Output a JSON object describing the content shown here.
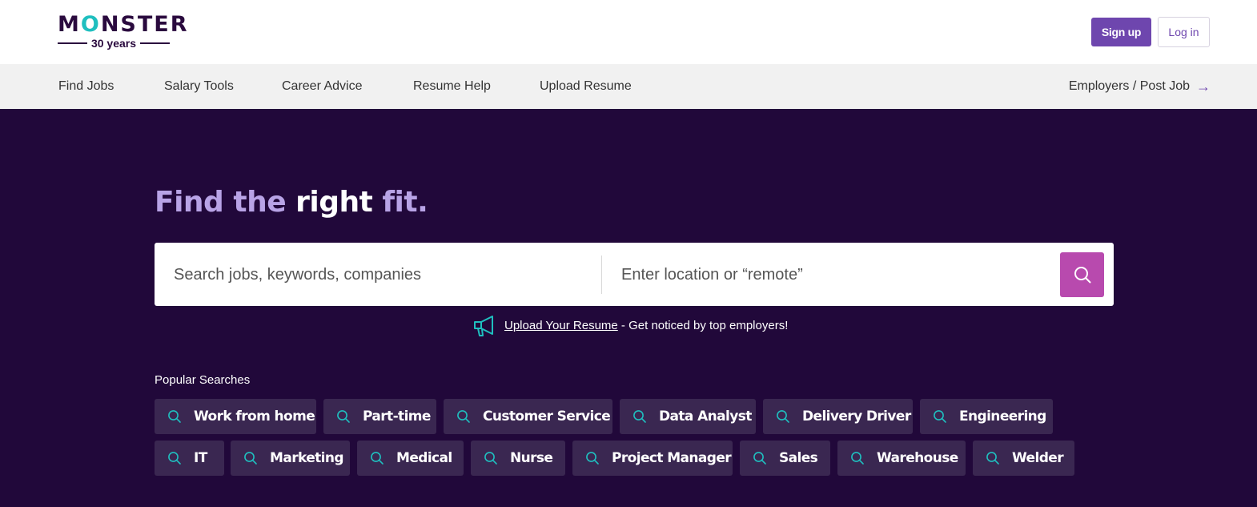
{
  "brand": {
    "name": "MONSTER",
    "tagline": "30 years",
    "colors": {
      "accent": "#6e46ae",
      "hero_bg": "#21083a",
      "teal": "#1fbfbf",
      "search_button": "#b84aae"
    }
  },
  "header": {
    "signup_label": "Sign up",
    "login_label": "Log in"
  },
  "nav": {
    "items": [
      {
        "label": "Find Jobs"
      },
      {
        "label": "Salary Tools"
      },
      {
        "label": "Career Advice"
      },
      {
        "label": "Resume Help"
      },
      {
        "label": "Upload Resume"
      }
    ],
    "employers_label": "Employers / Post Job",
    "employers_icon": "arrow-right-icon"
  },
  "hero": {
    "headline_part1": "Find the ",
    "headline_part2": "right",
    "headline_part3": " fit.",
    "search": {
      "keywords_placeholder": "Search jobs, keywords, companies",
      "keywords_value": "",
      "location_placeholder": "Enter location or “remote”",
      "location_value": "",
      "button_icon": "search-icon"
    },
    "upload": {
      "icon": "megaphone-icon",
      "link_text": "Upload Your Resume",
      "tail_text": " - Get noticed by top employers!"
    },
    "popular": {
      "label": "Popular Searches",
      "chip_icon": "search-icon",
      "chips": [
        "Work from home",
        "Part-time",
        "Customer Service",
        "Data Analyst",
        "Delivery Driver",
        "Engineering",
        "IT",
        "Marketing",
        "Medical",
        "Nurse",
        "Project Manager",
        "Sales",
        "Warehouse",
        "Welder"
      ]
    }
  }
}
